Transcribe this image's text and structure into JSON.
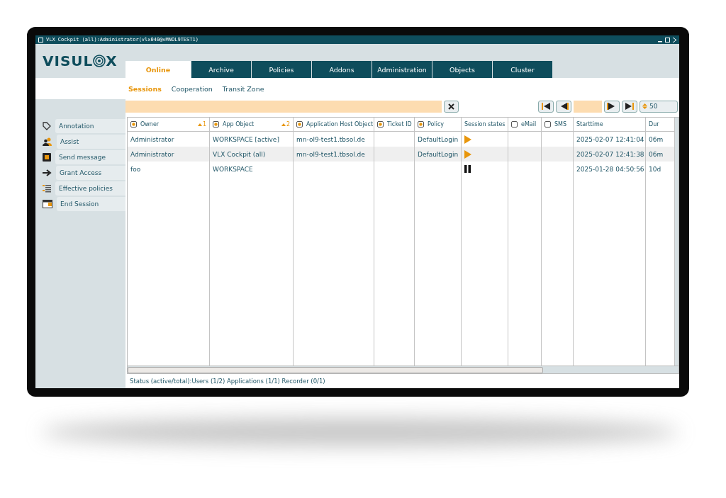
{
  "window": {
    "title": "VLX Cockpit (all):Administrator(vlx040@vMNOL9TEST1)"
  },
  "logo": {
    "before": "VISUL",
    "after": "X"
  },
  "tabs": [
    {
      "label": "Online",
      "selected": true
    },
    {
      "label": "Archive",
      "selected": false
    },
    {
      "label": "Policies",
      "selected": false
    },
    {
      "label": "Addons",
      "selected": false
    },
    {
      "label": "Administration",
      "selected": false
    },
    {
      "label": "Objects",
      "selected": false
    },
    {
      "label": "Cluster",
      "selected": false
    }
  ],
  "subtabs": [
    {
      "label": "Sessions",
      "selected": true
    },
    {
      "label": "Cooperation",
      "selected": false
    },
    {
      "label": "Transit Zone",
      "selected": false
    }
  ],
  "sidebar": {
    "items": [
      {
        "label": "Annotation",
        "kind": "tag"
      },
      {
        "label": "Assist",
        "kind": "people"
      },
      {
        "label": "Send message",
        "kind": "message"
      },
      {
        "label": "Grant Access",
        "kind": "arrow"
      },
      {
        "label": "Effective policies",
        "kind": "list"
      },
      {
        "label": "End Session",
        "kind": "end"
      }
    ]
  },
  "pager": {
    "page_size": "50"
  },
  "table": {
    "columns": [
      {
        "label": "Owner",
        "kind": "check",
        "checked": true,
        "sort": "1"
      },
      {
        "label": "App Object",
        "kind": "check",
        "checked": true,
        "sort": "2"
      },
      {
        "label": "Application Host Object",
        "kind": "check",
        "checked": true
      },
      {
        "label": "Ticket ID",
        "kind": "check",
        "checked": true
      },
      {
        "label": "Policy",
        "kind": "check",
        "checked": true
      },
      {
        "label": "Session states",
        "kind": "plain"
      },
      {
        "label": "eMail",
        "kind": "check",
        "checked": false
      },
      {
        "label": "SMS",
        "kind": "check",
        "checked": false
      },
      {
        "label": "Starttime",
        "kind": "plain"
      },
      {
        "label": "Dur",
        "kind": "plain"
      }
    ],
    "rows": [
      {
        "owner": "Administrator",
        "app": "WORKSPACE [active]",
        "host": "mn-ol9-test1.tbsol.de",
        "ticket": "",
        "policy": "DefaultLogin",
        "kind": "play",
        "email": "",
        "sms": "",
        "start": "2025-02-07 12:41:04",
        "dur": "06m"
      },
      {
        "owner": "Administrator",
        "app": "VLX Cockpit (all)",
        "host": "mn-ol9-test1.tbsol.de",
        "ticket": "",
        "policy": "DefaultLogin",
        "kind": "play",
        "email": "",
        "sms": "",
        "start": "2025-02-07 12:41:38",
        "dur": "06m"
      },
      {
        "owner": "foo",
        "app": "WORKSPACE",
        "host": "",
        "ticket": "",
        "policy": "",
        "kind": "pause",
        "email": "",
        "sms": "",
        "start": "2025-01-28 04:50:56",
        "dur": "10d"
      }
    ]
  },
  "status_bar": "Status (active/total):Users (1/2) Applications (1/1) Recorder (0/1)"
}
